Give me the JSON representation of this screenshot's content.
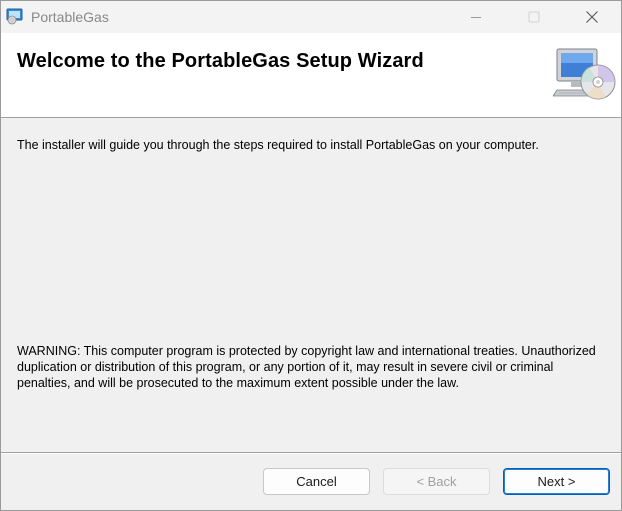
{
  "window": {
    "title": "PortableGas",
    "icons": {
      "app": "installer-app-icon",
      "minimize": "minimize-icon",
      "maximize": "maximize-icon",
      "close": "close-icon"
    }
  },
  "banner": {
    "title": "Welcome to the PortableGas Setup Wizard",
    "icon": "computer-cd-icon"
  },
  "body": {
    "intro": "The installer will guide you through the steps required to install PortableGas on your computer.",
    "warning": "WARNING: This computer program is protected by copyright law and international treaties. Unauthorized duplication or distribution of this program, or any portion of it, may result in severe civil or criminal penalties, and will be prosecuted to the maximum extent possible under the law."
  },
  "buttons": {
    "cancel": "Cancel",
    "back": "< Back",
    "back_enabled": false,
    "next": "Next >"
  },
  "colors": {
    "accent": "#005fb8",
    "window_bg": "#f0f0f0",
    "banner_bg": "#ffffff",
    "title_text": "#888888",
    "disabled_text": "#a0a0a0"
  }
}
